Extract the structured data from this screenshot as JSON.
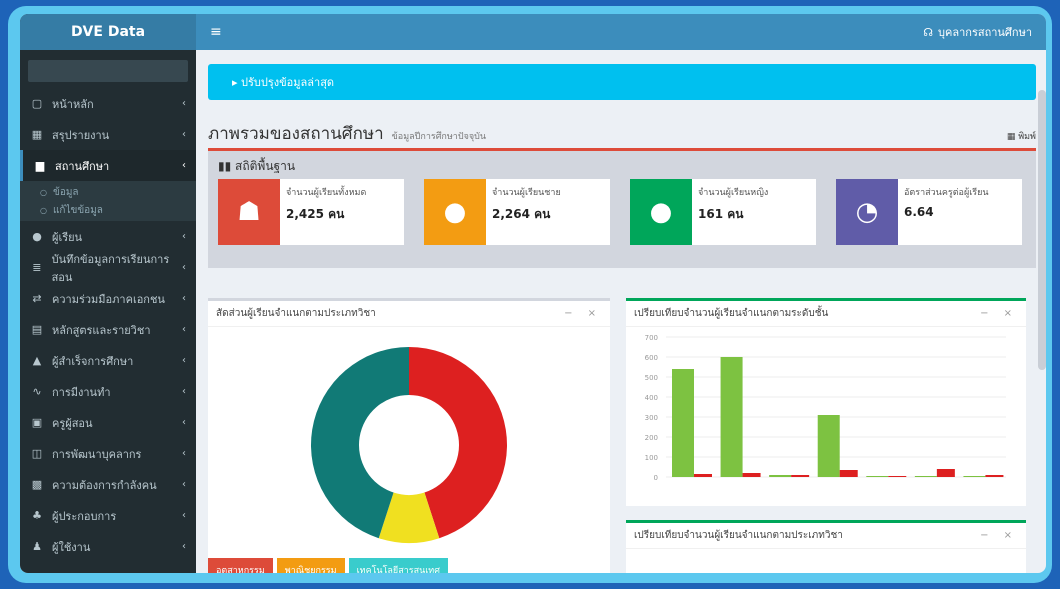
{
  "app": {
    "title": "DVE Data"
  },
  "topbar": {
    "hamburger_icon": "hamburger-icon",
    "user_name": "บุคลากรสถานศึกษา"
  },
  "sidebar": {
    "items": [
      {
        "label": "หน้าหลัก",
        "icon": "square-icon"
      },
      {
        "label": "สรุปรายงาน",
        "icon": "chart-icon"
      },
      {
        "label": "สถานศึกษา",
        "icon": "building-icon",
        "active": true
      },
      {
        "label": "ผู้เรียน",
        "icon": "user-icon"
      },
      {
        "label": "บันทึกข้อมูลการเรียนการสอน",
        "icon": "list-icon"
      },
      {
        "label": "ความร่วมมือภาคเอกชน",
        "icon": "handshake-icon"
      },
      {
        "label": "หลักสูตรและรายวิชา",
        "icon": "book-icon"
      },
      {
        "label": "ผู้สำเร็จการศึกษา",
        "icon": "graduate-icon"
      },
      {
        "label": "การมีงานทำ",
        "icon": "line-chart-icon"
      },
      {
        "label": "ครูผู้สอน",
        "icon": "teacher-icon"
      },
      {
        "label": "การพัฒนาบุคลากร",
        "icon": "training-icon"
      },
      {
        "label": "ความต้องการกำลังคน",
        "icon": "workforce-icon"
      },
      {
        "label": "ผู้ประกอบการ",
        "icon": "group-icon"
      },
      {
        "label": "ผู้ใช้งาน",
        "icon": "person-icon"
      }
    ],
    "submenu": [
      {
        "label": "ข้อมูล",
        "icon": "circle-icon"
      },
      {
        "label": "แก้ไขข้อมูล",
        "icon": "circle-icon"
      }
    ]
  },
  "callout": {
    "text": "▸ ปรับปรุงข้อมูลล่าสุด"
  },
  "page": {
    "title": "ภาพรวมของสถานศึกษา",
    "subtitle": "ข้อมูลปีการศึกษาปัจจุบัน",
    "print_label": "พิมพ์"
  },
  "stats": {
    "title": "สถิติพื้นฐาน",
    "cards": [
      {
        "label": "จำนวนผู้เรียนทั้งหมด",
        "value": "2,425 คน",
        "color": "#dd4b39",
        "icon": "users-icon"
      },
      {
        "label": "จำนวนผู้เรียนชาย",
        "value": "2,264 คน",
        "color": "#f39c12",
        "icon": "user-icon"
      },
      {
        "label": "จำนวนผู้เรียนหญิง",
        "value": "161 คน",
        "color": "#00a65a",
        "icon": "user-icon"
      },
      {
        "label": "อัตราส่วนครูต่อผู้เรียน",
        "value": "6.64",
        "color": "#605ca8",
        "icon": "pie-icon"
      }
    ]
  },
  "donut_panel": {
    "title": "สัดส่วนผู้เรียนจำแนกตามประเภทวิชา",
    "legend": [
      {
        "label": "อุตสาหกรรม",
        "color": "#dd4b39"
      },
      {
        "label": "พาณิชยกรรม",
        "color": "#f39c12"
      },
      {
        "label": "เทคโนโลยีสารสนเทศ",
        "color": "#39cccc"
      }
    ]
  },
  "bar_panel": {
    "title": "เปรียบเทียบจำนวนผู้เรียนจำแนกตามระดับชั้น"
  },
  "bar_panel2": {
    "title": "เปรียบเทียบจำนวนผู้เรียนจำแนกตามประเภทวิชา"
  },
  "chart_data": [
    {
      "type": "pie",
      "categories": [
        "",
        "",
        ""
      ],
      "values": [
        45,
        10,
        45
      ],
      "colors": [
        "#dd2020",
        "#f0e020",
        "#117a76"
      ]
    },
    {
      "type": "bar",
      "categories": [
        "",
        "",
        "",
        "",
        "",
        "",
        ""
      ],
      "series": [
        {
          "values": [
            540,
            600,
            10,
            310,
            5,
            5,
            5
          ],
          "color": "#7dc241"
        },
        {
          "values": [
            15,
            20,
            10,
            35,
            5,
            40,
            10
          ],
          "color": "#dd2020"
        }
      ],
      "ylim": [
        0,
        700
      ],
      "yticks": [
        0,
        100,
        200,
        300,
        400,
        500,
        600,
        700
      ]
    }
  ]
}
